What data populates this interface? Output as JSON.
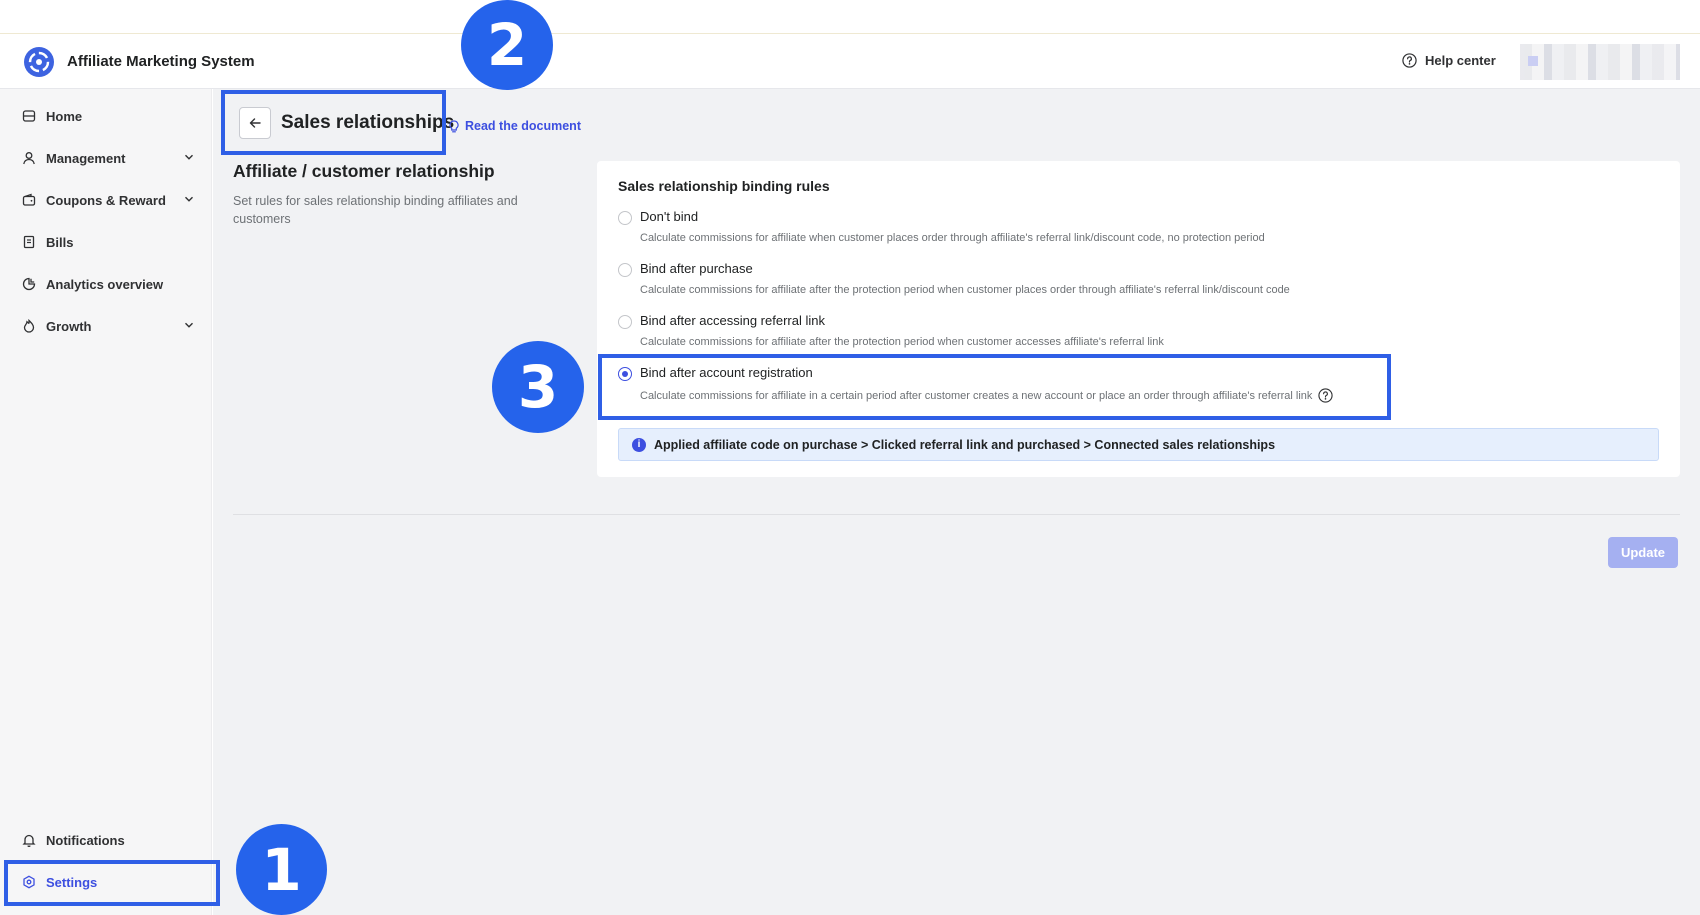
{
  "header": {
    "app_title": "Affiliate Marketing System",
    "help_label": "Help center"
  },
  "sidebar": {
    "items": [
      {
        "label": "Home",
        "icon": "home-icon"
      },
      {
        "label": "Management",
        "icon": "user-icon"
      },
      {
        "label": "Coupons & Reward",
        "icon": "wallet-icon"
      },
      {
        "label": "Bills",
        "icon": "bill-icon"
      },
      {
        "label": "Analytics overview",
        "icon": "analytics-icon"
      },
      {
        "label": "Growth",
        "icon": "growth-icon"
      }
    ],
    "bottom_items": [
      {
        "label": "Notifications",
        "icon": "bell-icon"
      },
      {
        "label": "Settings",
        "icon": "settings-icon",
        "active": true
      }
    ]
  },
  "page": {
    "title": "Sales relationships",
    "doc_link": "Read the document",
    "section_title": "Affiliate / customer relationship",
    "section_desc": "Set rules for sales relationship binding affiliates and customers"
  },
  "card": {
    "title": "Sales relationship binding rules",
    "options": [
      {
        "label": "Don't bind",
        "desc": "Calculate commissions for affiliate when customer places order through affiliate's referral link/discount code, no protection period",
        "selected": false
      },
      {
        "label": "Bind after purchase",
        "desc": "Calculate commissions for affiliate after the protection period when customer places order through affiliate's referral link/discount code",
        "selected": false
      },
      {
        "label": "Bind after accessing referral link",
        "desc": "Calculate commissions for affiliate after the protection period when customer accesses affiliate's referral link",
        "selected": false
      },
      {
        "label": "Bind after account registration",
        "desc": "Calculate commissions for affiliate in a certain period after customer creates a new account or place an order through affiliate's referral link",
        "selected": true
      }
    ],
    "info": "Applied affiliate code on purchase > Clicked referral link and purchased > Connected sales relationships"
  },
  "actions": {
    "update_label": "Update"
  },
  "annotations": {
    "badge_1": "1",
    "badge_2": "2",
    "badge_3": "3"
  },
  "colors": {
    "accent": "#3d4fe0",
    "badge": "#2563eb",
    "update_disabled": "#a5b0f1"
  }
}
